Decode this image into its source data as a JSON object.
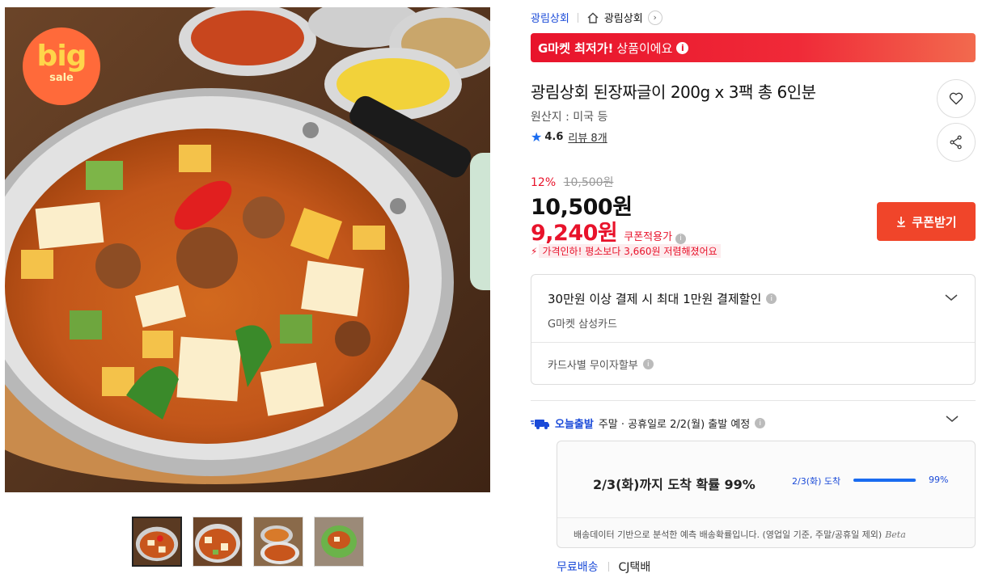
{
  "gallery": {
    "badge": {
      "line1": "big",
      "line2": "sale"
    },
    "thumbnails": [
      "thumb-1",
      "thumb-2",
      "thumb-3",
      "thumb-4"
    ],
    "selected_index": 0
  },
  "breadcrumb": {
    "seller": "광림상회",
    "store": "광림상회"
  },
  "banner": {
    "strong": "G마켓 최저가!",
    "rest": "상품이에요",
    "info_glyph": "i"
  },
  "product": {
    "title": "광림상회 된장짜글이 200g x 3팩 총 6인분",
    "origin": "원산지 : 미국 등",
    "rating": "4.6",
    "review_link": "리뷰 8개"
  },
  "pricing": {
    "discount_rate": "12%",
    "original_price": "10,500원",
    "price": "10,500원",
    "coupon_price": "9,240원",
    "coupon_label": "쿠폰적용가",
    "price_drop_note": "가격인하! 평소보다 3,660원 저렴해졌어요",
    "coupon_button": "쿠폰받기"
  },
  "card_promo": {
    "headline": "30만원 이상 결제 시 최대 1만원 결제할인",
    "card_name": "G마켓 삼성카드",
    "installment": "카드사별 무이자할부"
  },
  "shipping": {
    "today_label": "오늘출발",
    "schedule": "주말 · 공휴일로 2/2(월) 출발 예정",
    "probability_headline": "2/3(화)까지 도착 확률 99%",
    "arrive_label": "2/3(화) 도착",
    "arrive_pct": "99%",
    "arrive_fraction": 0.99,
    "note": "배송데이터 기반으로 분석한 예측 배송확률입니다. (영업일 기준, 주말/공휴일 제외)",
    "beta": "Beta",
    "free_shipping": "무료배송",
    "carrier": "CJ택배"
  },
  "icons": {
    "home": "home-icon",
    "heart": "heart-icon",
    "share": "share-icon",
    "chevron": "chevron-down-icon",
    "star": "star-icon",
    "truck": "truck-icon"
  },
  "colors": {
    "accent_red": "#e8132b",
    "coupon_button": "#f0452a",
    "link_blue": "#1a4ad8",
    "star_blue": "#1a6cf0",
    "badge_orange": "#ff6a3a"
  }
}
